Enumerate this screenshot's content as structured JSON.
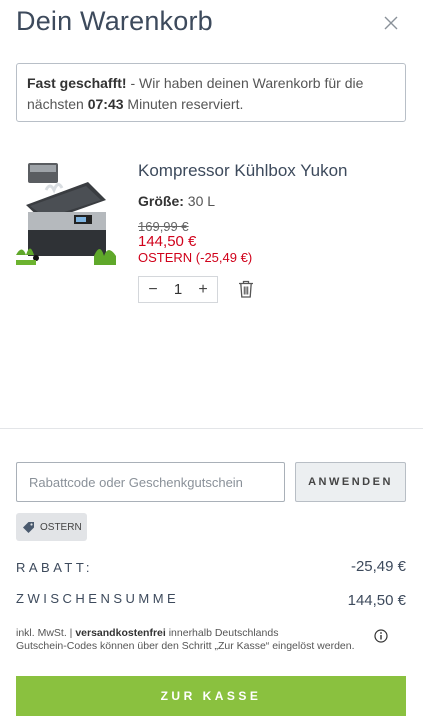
{
  "header": {
    "title": "Dein Warenkorb"
  },
  "notice": {
    "lead": "Fast geschafft!",
    "text1": " - Wir haben deinen Warenkorb für die nächsten ",
    "time": "07:43",
    "text2": " Minuten reserviert."
  },
  "item": {
    "name": "Kompressor Kühlbox Yukon",
    "size_label": "Größe:",
    "size_value": " 30 L",
    "old_price": "169,99 €",
    "new_price": "144,50 €",
    "discount": "OSTERN (-25,49 €)",
    "quantity": "1",
    "minus": "−",
    "plus": "+"
  },
  "coupon": {
    "placeholder": "Rabattcode oder Geschenkgutschein",
    "apply_label": "ANWENDEN",
    "applied_tag": "OSTERN"
  },
  "totals": {
    "discount_label": "RABATT:",
    "discount_value": "-25,49 €",
    "subtotal_label": "ZWISCHENSUMME",
    "subtotal_value": "144,50 €"
  },
  "footer": {
    "tax_note": "inkl. MwSt. | ",
    "shipping_bold": "versandkostenfrei",
    "shipping_rest": " innerhalb Deutschlands",
    "coupon_note": "Gutschein-Codes können über den Schritt „Zur Kasse“ eingelöst werden.",
    "checkout_label": "ZUR KASSE"
  },
  "colors": {
    "accent": "#8ac13f",
    "sale": "#d0021b",
    "heading": "#3d4a5c"
  },
  "icons": {
    "close": "close-icon",
    "trash": "trash-icon",
    "tag": "tag-icon",
    "info": "info-icon"
  }
}
